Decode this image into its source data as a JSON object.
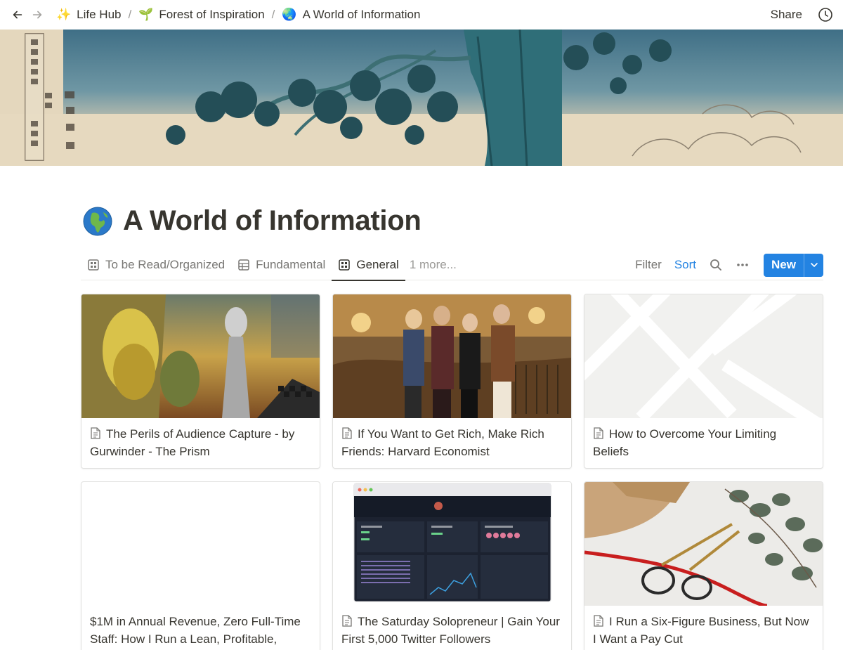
{
  "topbar": {
    "back_icon": "arrow-left-icon",
    "forward_icon": "arrow-right-icon",
    "breadcrumbs": [
      {
        "emoji": "✨",
        "label": "Life Hub"
      },
      {
        "emoji": "🌱",
        "label": "Forest of Inspiration"
      },
      {
        "emoji": "🌏",
        "label": "A World of Information"
      }
    ],
    "separator": "/",
    "share_label": "Share",
    "history_icon": "clock-icon"
  },
  "page": {
    "title_emoji": "globe-asia-icon",
    "title": "A World of Information"
  },
  "views": {
    "tabs": [
      {
        "label": "To be Read/Organized",
        "icon": "gallery-icon",
        "active": false
      },
      {
        "label": "Fundamental",
        "icon": "table-icon",
        "active": false
      },
      {
        "label": "General",
        "icon": "gallery-icon",
        "active": true
      }
    ],
    "more_label": "1 more...",
    "filter_label": "Filter",
    "sort_label": "Sort",
    "search_icon": "search-icon",
    "options_icon": "ellipsis-icon",
    "new_label": "New",
    "new_dropdown_icon": "chevron-down-icon"
  },
  "cards": [
    {
      "title": "The Perils of Audience Capture - by Gurwinder - The Prism",
      "cover": "surreal-painting"
    },
    {
      "title": "If You Want to Get Rich, Make Rich Friends: Harvard Economist",
      "cover": "group-photo"
    },
    {
      "title": "How to Overcome Your Limiting Beliefs",
      "cover": "placeholder"
    },
    {
      "title": "$1M in Annual Revenue, Zero Full-Time Staff: How I Run a Lean, Profitable,",
      "cover": "blank"
    },
    {
      "title": "The Saturday Solopreneur | Gain Your First 5,000 Twitter Followers",
      "cover": "dashboard-screenshot"
    },
    {
      "title": "I Run a Six-Figure Business, But Now I Want a Pay Cut",
      "cover": "scissors-ribbon-photo"
    }
  ],
  "colors": {
    "accent": "#2383e2",
    "text": "#37352f",
    "muted": "#787774",
    "border": "#e9e9e7"
  }
}
